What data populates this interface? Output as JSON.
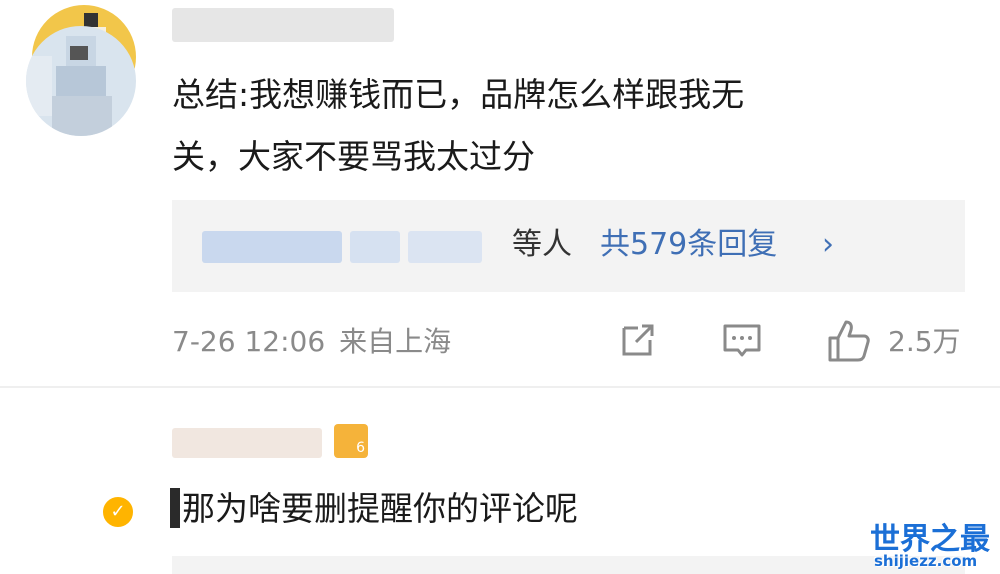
{
  "comments": [
    {
      "text_line1": "总结:我想赚钱而已，品牌怎么样跟我无",
      "text_line2": "关，大家不要骂我太过分",
      "replies": {
        "suffix": "等人",
        "count_label": "共579条回复",
        "chevron": "›"
      },
      "timestamp": "7-26 12:06",
      "location": "来自上海",
      "likes": "2.5万"
    },
    {
      "level_badge": "6",
      "text": "那为啥要删提醒你的评论呢",
      "verified_mark": "✓"
    }
  ],
  "icons": {
    "share": "share-icon",
    "comment": "comment-icon",
    "like": "thumbs-up-icon"
  },
  "colors": {
    "link": "#3f6fb5",
    "meta": "#8a8a8a",
    "avatar_1": "#f2c64a",
    "badge": "#f5b33a",
    "verified": "#ffb400"
  },
  "watermark": {
    "logo": "世界之最",
    "url": "shijiezz.com"
  }
}
